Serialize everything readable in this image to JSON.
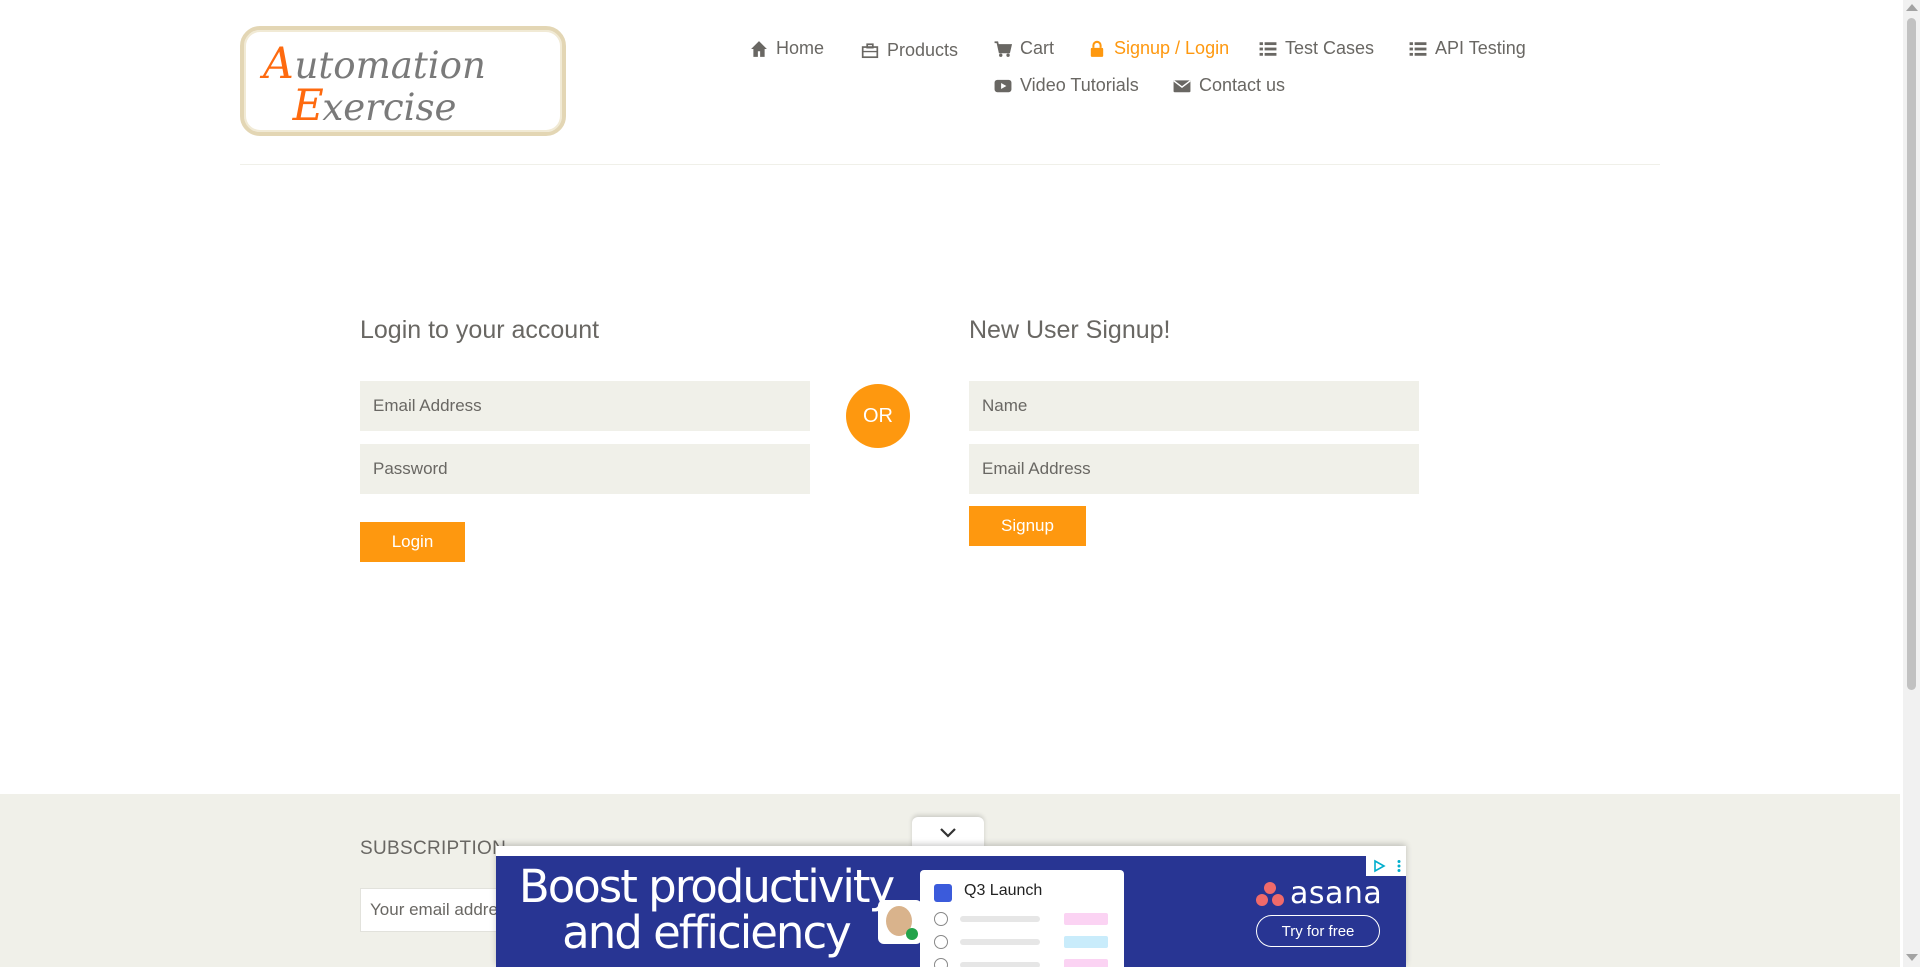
{
  "header": {
    "logo_text": "Automation Exercise",
    "nav": [
      {
        "label": "Home",
        "icon": "home-icon"
      },
      {
        "label": "Products",
        "icon": "briefcase-icon"
      },
      {
        "label": "Cart",
        "icon": "cart-icon"
      },
      {
        "label": "Signup / Login",
        "icon": "lock-icon",
        "active": true
      },
      {
        "label": "Test Cases",
        "icon": "list-icon"
      },
      {
        "label": "API Testing",
        "icon": "list-icon"
      },
      {
        "label": "Video Tutorials",
        "icon": "youtube-icon"
      },
      {
        "label": "Contact us",
        "icon": "envelope-icon"
      }
    ]
  },
  "login": {
    "title": "Login to your account",
    "email_placeholder": "Email Address",
    "password_placeholder": "Password",
    "button": "Login"
  },
  "separator": "OR",
  "signup": {
    "title": "New User Signup!",
    "name_placeholder": "Name",
    "email_placeholder": "Email Address",
    "button": "Signup"
  },
  "footer": {
    "subscription_title": "SUBSCRIPTION",
    "email_placeholder": "Your email address"
  },
  "ad": {
    "headline": "Boost productivity and efficiency",
    "card_title": "Q3 Launch",
    "brand": "asana",
    "cta": "Try for free"
  },
  "colors": {
    "accent": "#fe980f",
    "field_bg": "#f0f0e9",
    "text": "#696763",
    "ad_bg": "#283593"
  }
}
